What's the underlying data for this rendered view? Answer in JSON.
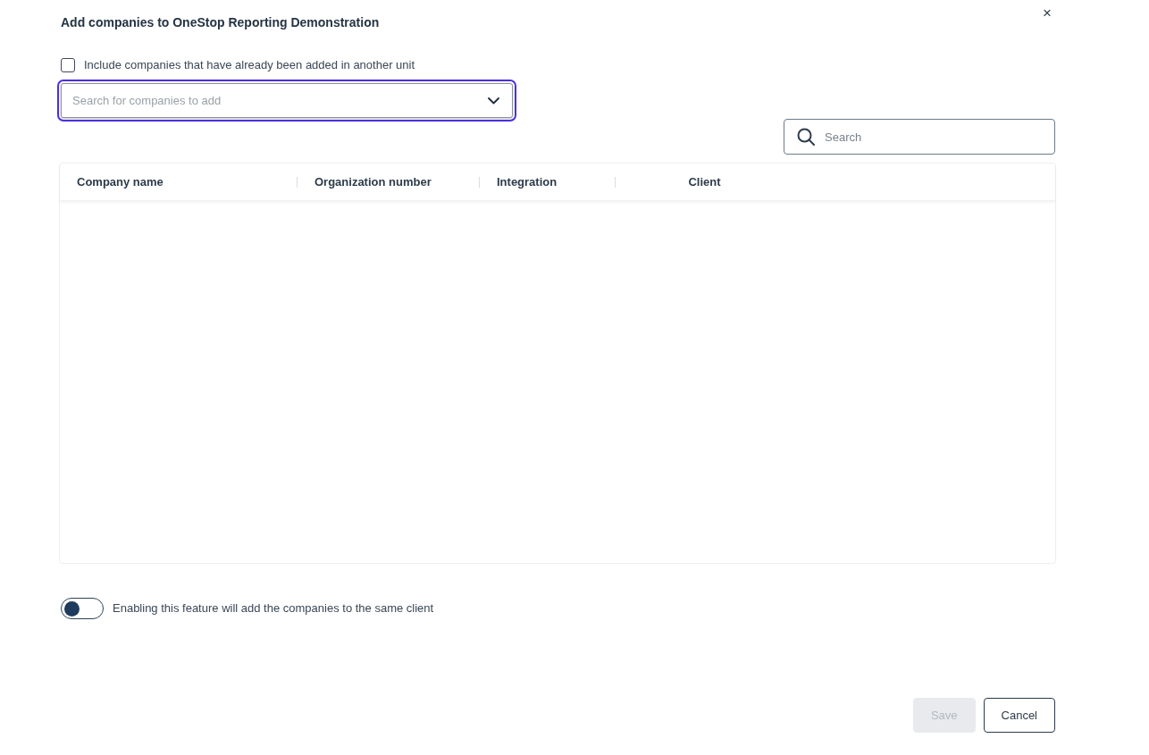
{
  "dialog": {
    "title": "Add companies to OneStop Reporting Demonstration",
    "close": "×"
  },
  "include_checkbox": {
    "label": "Include companies that have already been added in another unit",
    "checked": false
  },
  "company_select": {
    "placeholder": "Search for companies to add",
    "focused": true
  },
  "table_search": {
    "placeholder": "Search"
  },
  "table": {
    "columns": [
      {
        "label": "Company name"
      },
      {
        "label": "Organization number"
      },
      {
        "label": "Integration"
      },
      {
        "label": "Client"
      }
    ]
  },
  "same_client_toggle": {
    "label": "Enabling this feature will add the companies to the same client",
    "on": false
  },
  "buttons": [
    {
      "label": "Save",
      "kind": "primary",
      "disabled": true
    },
    {
      "label": "Cancel",
      "kind": "secondary",
      "disabled": false
    }
  ]
}
